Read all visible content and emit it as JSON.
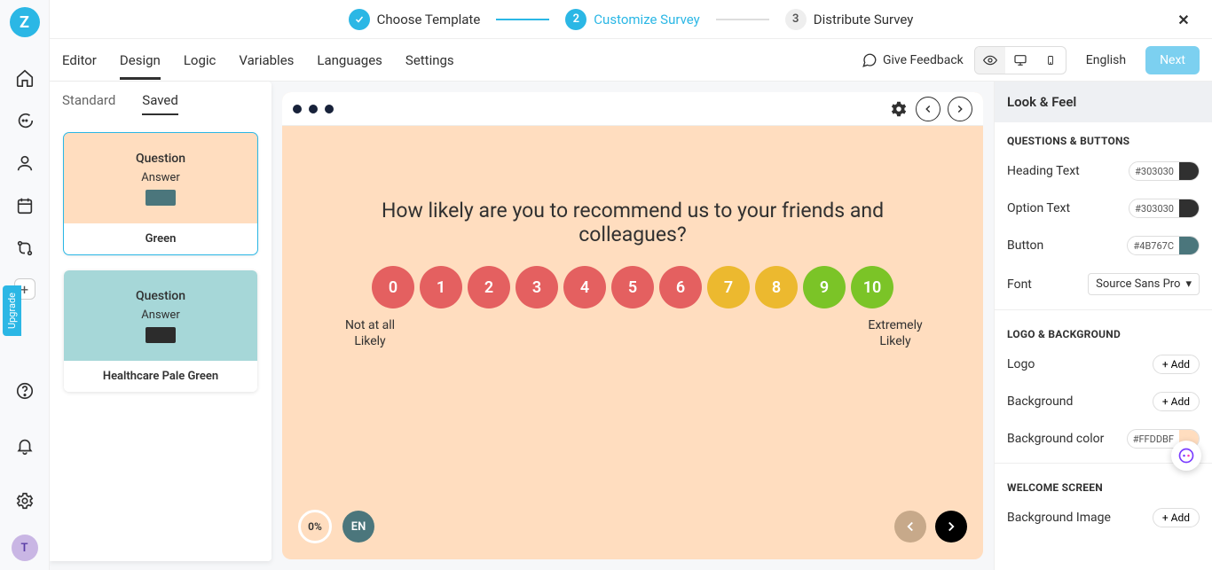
{
  "stepper": {
    "steps": [
      {
        "num": "✓",
        "label": "Choose Template",
        "state": "done"
      },
      {
        "num": "2",
        "label": "Customize Survey",
        "state": "active"
      },
      {
        "num": "3",
        "label": "Distribute Survey",
        "state": "todo"
      }
    ]
  },
  "toolbar": {
    "tabs": [
      "Editor",
      "Design",
      "Logic",
      "Variables",
      "Languages",
      "Settings"
    ],
    "selected": "Design",
    "feedback": "Give Feedback",
    "language": "English",
    "next": "Next"
  },
  "design_panel": {
    "tabs": {
      "standard": "Standard",
      "saved": "Saved",
      "selected": "Saved"
    },
    "themes": [
      {
        "name": "Green",
        "q": "Question",
        "a": "Answer",
        "class": "green",
        "selected": true
      },
      {
        "name": "Healthcare Pale Green",
        "q": "Question",
        "a": "Answer",
        "class": "healthcare",
        "selected": false
      }
    ]
  },
  "survey": {
    "question": "How likely are you to recommend us to your friends and colleagues?",
    "scale": [
      {
        "n": "0",
        "color": "#e46060"
      },
      {
        "n": "1",
        "color": "#e46060"
      },
      {
        "n": "2",
        "color": "#e46060"
      },
      {
        "n": "3",
        "color": "#e46060"
      },
      {
        "n": "4",
        "color": "#e46060"
      },
      {
        "n": "5",
        "color": "#e46060"
      },
      {
        "n": "6",
        "color": "#e46060"
      },
      {
        "n": "7",
        "color": "#ecb92f"
      },
      {
        "n": "8",
        "color": "#ecb92f"
      },
      {
        "n": "9",
        "color": "#7bc427"
      },
      {
        "n": "10",
        "color": "#7bc427"
      }
    ],
    "low_label": "Not at all Likely",
    "high_label": "Extremely Likely",
    "progress": "0%",
    "lang_code": "EN"
  },
  "look_feel": {
    "title": "Look & Feel",
    "sections": {
      "questions_buttons": {
        "title": "QUESTIONS & BUTTONS",
        "heading_text": {
          "label": "Heading Text",
          "code": "#303030",
          "swatch": "#303030"
        },
        "option_text": {
          "label": "Option Text",
          "code": "#303030",
          "swatch": "#303030"
        },
        "button": {
          "label": "Button",
          "code": "#4B767C",
          "swatch": "#4B767C"
        },
        "font": {
          "label": "Font",
          "value": "Source Sans Pro"
        }
      },
      "logo_background": {
        "title": "LOGO & BACKGROUND",
        "logo": {
          "label": "Logo",
          "action": "+ Add"
        },
        "background": {
          "label": "Background",
          "action": "+ Add"
        },
        "bg_color": {
          "label": "Background color",
          "code": "#FFDDBF",
          "swatch": "#FFDDBF"
        }
      },
      "welcome": {
        "title": "WELCOME SCREEN",
        "bg_image": {
          "label": "Background Image",
          "action": "+ Add"
        }
      }
    }
  },
  "logo_letter": "Z",
  "avatar_letter": "T",
  "upgrade": "Upgrade"
}
